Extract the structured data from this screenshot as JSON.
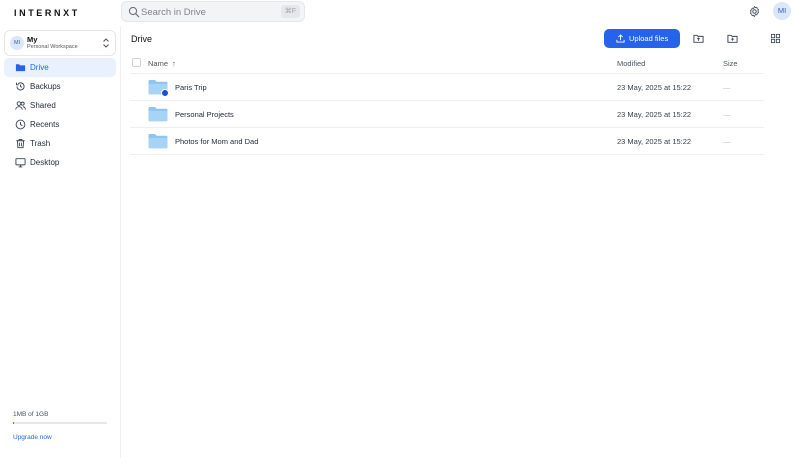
{
  "app": {
    "logo": "INTERNXT"
  },
  "search": {
    "placeholder": "Search in Drive",
    "shortcut": "⌘F"
  },
  "user": {
    "initials": "MI"
  },
  "workspace": {
    "initials": "MI",
    "name": "My",
    "subtitle": "Personal Workspace"
  },
  "sidebar": {
    "items": [
      {
        "label": "Drive",
        "icon": "folder-icon",
        "active": true
      },
      {
        "label": "Backups",
        "icon": "history-icon"
      },
      {
        "label": "Shared",
        "icon": "users-icon"
      },
      {
        "label": "Recents",
        "icon": "clock-icon"
      },
      {
        "label": "Trash",
        "icon": "trash-icon"
      },
      {
        "label": "Desktop",
        "icon": "desktop-icon"
      }
    ],
    "usage": {
      "text": "1MB of 1GB",
      "fraction": 0.01
    },
    "upgrade_label": "Upgrade now"
  },
  "main": {
    "title": "Drive",
    "upload_label": "Upload files",
    "columns": {
      "name": "Name",
      "sort_indicator": "↑",
      "modified": "Modified",
      "size": "Size"
    },
    "rows": [
      {
        "name": "Paris Trip",
        "modified": "23 May, 2025 at 15:22",
        "size": "—",
        "shared": true
      },
      {
        "name": "Personal Projects",
        "modified": "23 May, 2025 at 15:22",
        "size": "—",
        "shared": false
      },
      {
        "name": "Photos for Mom and Dad",
        "modified": "23 May, 2025 at 15:22",
        "size": "—",
        "shared": false
      }
    ]
  },
  "colors": {
    "accent": "#2563eb",
    "active_bg": "#eaf1fe",
    "folder": "#8ec5f1"
  }
}
